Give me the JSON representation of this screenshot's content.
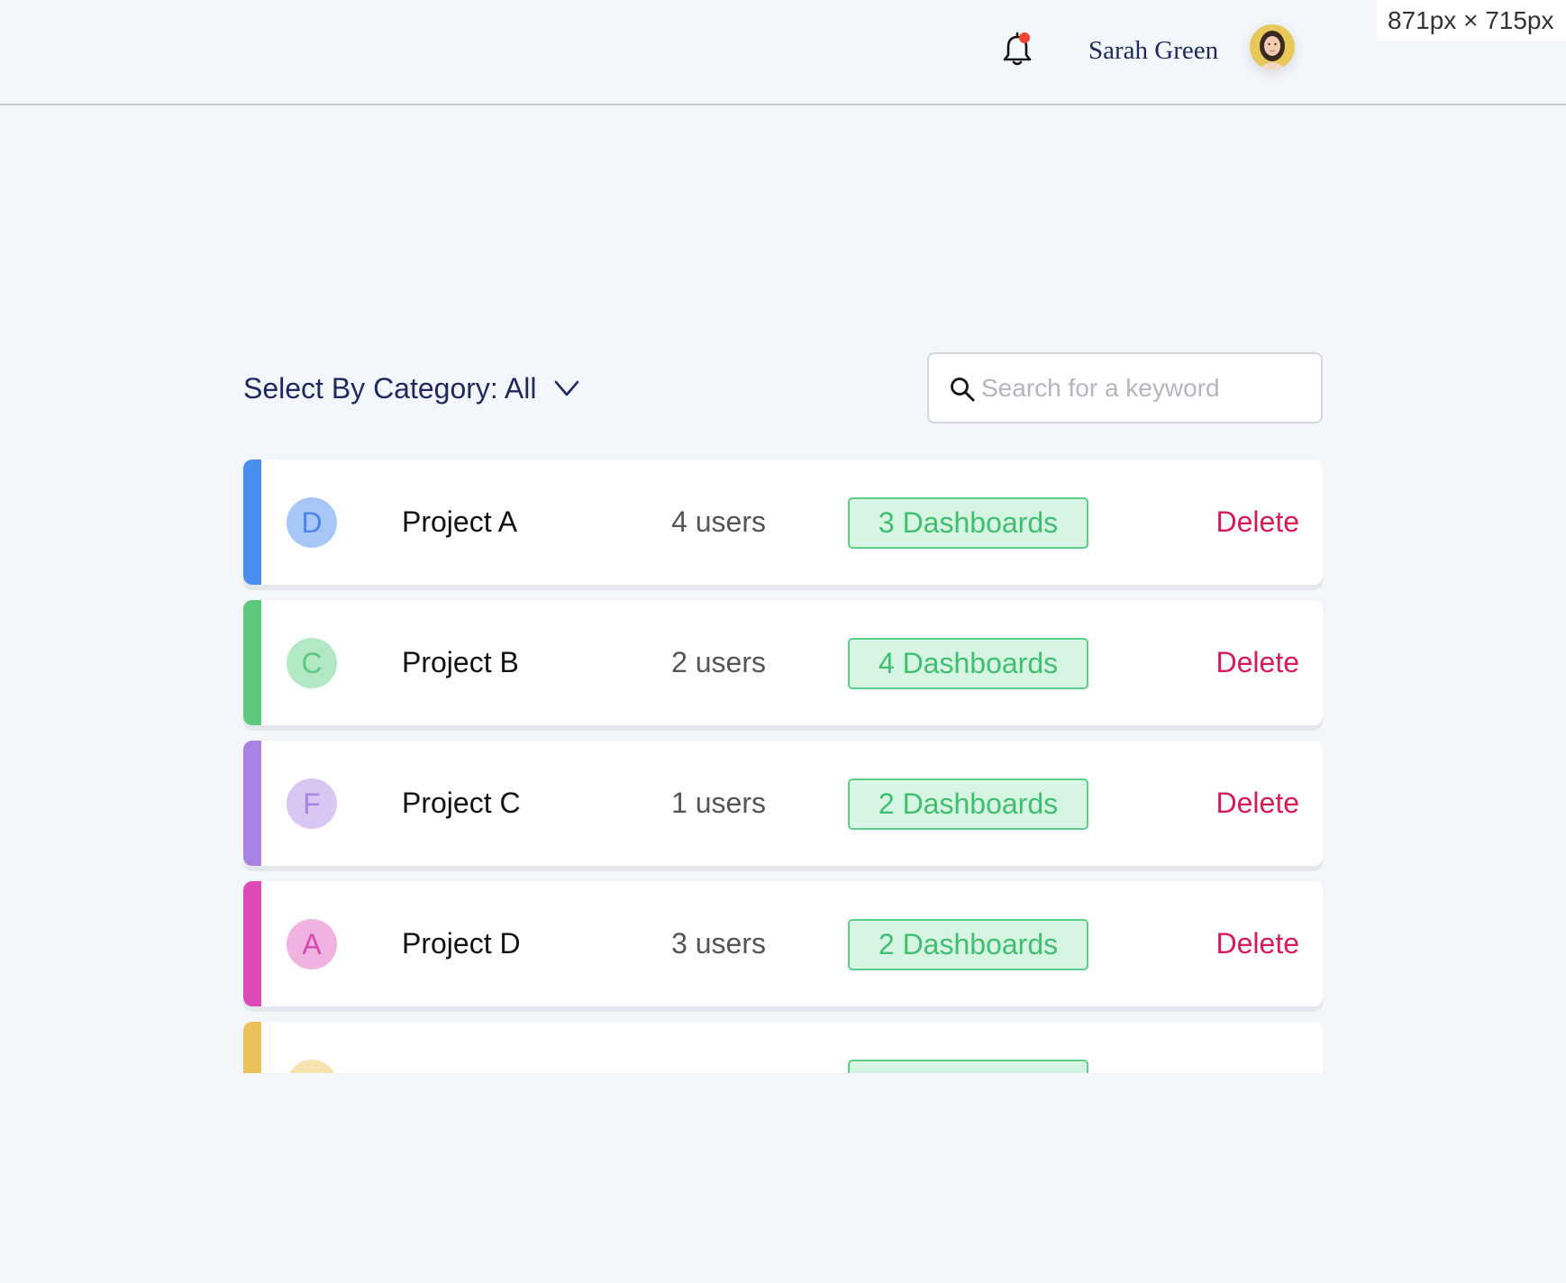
{
  "header": {
    "user_name": "Sarah Green",
    "notification_dot_color": "#f44336",
    "size_readout": "871px × 715px"
  },
  "toolbar": {
    "category_label": "Select By Category: All",
    "search_placeholder": "Search for a keyword"
  },
  "projects": [
    {
      "letter": "D",
      "name": "Project A",
      "users": "4 users",
      "dashboards": "3 Dashboards",
      "delete_label": "Delete",
      "accent": "#4a8ff0",
      "badge_bg": "#a7c7f8",
      "badge_fg": "#4a86e8"
    },
    {
      "letter": "C",
      "name": "Project B",
      "users": "2 users",
      "dashboards": "4 Dashboards",
      "delete_label": "Delete",
      "accent": "#5cc97c",
      "badge_bg": "#b3e8c5",
      "badge_fg": "#5cc97c"
    },
    {
      "letter": "F",
      "name": "Project C",
      "users": "1 users",
      "dashboards": "2 Dashboards",
      "delete_label": "Delete",
      "accent": "#a983e4",
      "badge_bg": "#d9c7f3",
      "badge_fg": "#a983e4"
    },
    {
      "letter": "A",
      "name": "Project D",
      "users": "3 users",
      "dashboards": "2 Dashboards",
      "delete_label": "Delete",
      "accent": "#de4bb8",
      "badge_bg": "#f0b2e0",
      "badge_fg": "#d64aaf"
    },
    {
      "letter": "",
      "name": "",
      "users": "",
      "dashboards": "",
      "delete_label": "",
      "accent": "#ebc25a",
      "badge_bg": "#f6e3b0",
      "badge_fg": "#d9a93a"
    }
  ],
  "icons": {
    "bell": "bell-icon",
    "chevron": "chevron-down-icon",
    "search": "search-icon",
    "avatar": "avatar"
  }
}
